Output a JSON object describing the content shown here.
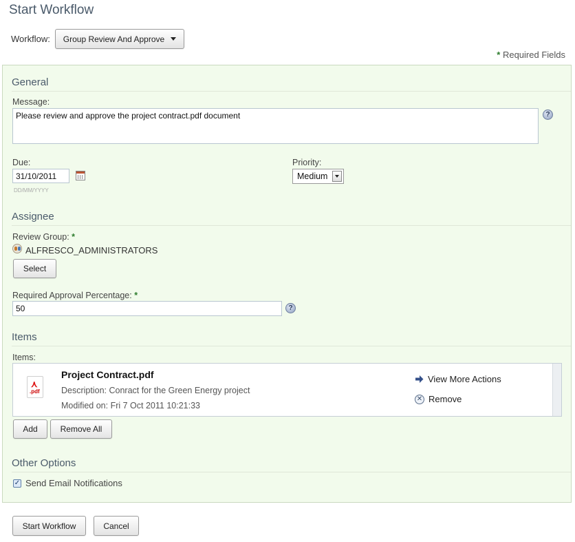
{
  "page": {
    "title": "Start Workflow"
  },
  "workflow": {
    "label": "Workflow:",
    "selected": "Group Review And Approve"
  },
  "required_fields": {
    "star": "*",
    "text": "Required Fields"
  },
  "general": {
    "heading": "General",
    "message_label": "Message:",
    "message_value": "Please review and approve the project contract.pdf document",
    "due_label": "Due:",
    "due_value": "31/10/2011",
    "due_hint": "DD/MM/YYYY",
    "priority_label": "Priority:",
    "priority_value": "Medium"
  },
  "assignee": {
    "heading": "Assignee",
    "review_group_label": "Review Group:",
    "required_star": "*",
    "group_name": "ALFRESCO_ADMINISTRATORS",
    "select_button": "Select",
    "approval_label": "Required Approval Percentage:",
    "approval_value": "50"
  },
  "items": {
    "heading": "Items",
    "items_label": "Items:",
    "list": [
      {
        "name": "Project Contract.pdf",
        "description": "Description: Conract for the Green Energy project",
        "modified": "Modified on: Fri 7 Oct 2011 10:21:33",
        "icon_ext": ".pdf"
      }
    ],
    "view_more_actions": "View More Actions",
    "remove": "Remove",
    "add_button": "Add",
    "remove_all_button": "Remove All"
  },
  "other_options": {
    "heading": "Other Options",
    "send_email_label": "Send Email Notifications",
    "send_email_checked": true
  },
  "footer": {
    "start_button": "Start Workflow",
    "cancel_button": "Cancel"
  },
  "colors": {
    "panel_bg": "#f2fbec",
    "required_star": "#2e7d2e",
    "heading": "#4a5a6a"
  }
}
